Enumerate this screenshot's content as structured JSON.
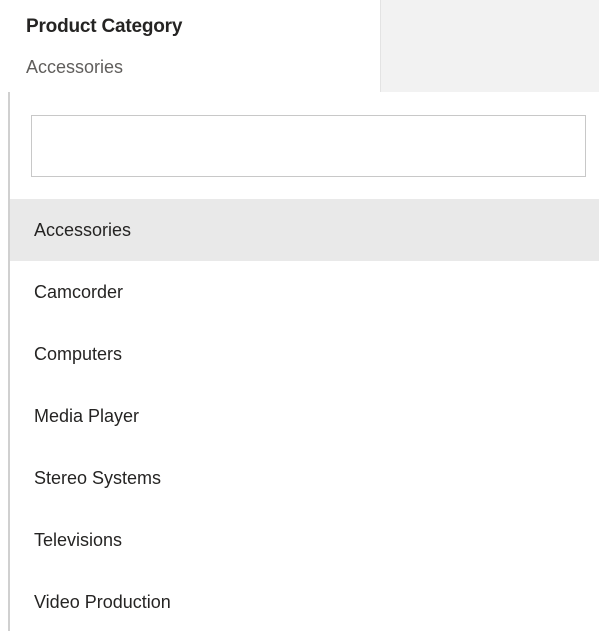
{
  "slicer": {
    "title": "Product Category",
    "selected_value": "Accessories"
  },
  "search": {
    "value": "",
    "placeholder": ""
  },
  "options": [
    {
      "label": "Accessories",
      "selected": true
    },
    {
      "label": "Camcorder",
      "selected": false
    },
    {
      "label": "Computers",
      "selected": false
    },
    {
      "label": "Media Player",
      "selected": false
    },
    {
      "label": "Stereo Systems",
      "selected": false
    },
    {
      "label": "Televisions",
      "selected": false
    },
    {
      "label": "Video Production",
      "selected": false
    }
  ],
  "colors": {
    "selected_row_bg": "#e9e9e9",
    "text": "#252423",
    "secondary_text": "#605e5c",
    "border": "#c8c8c8"
  }
}
